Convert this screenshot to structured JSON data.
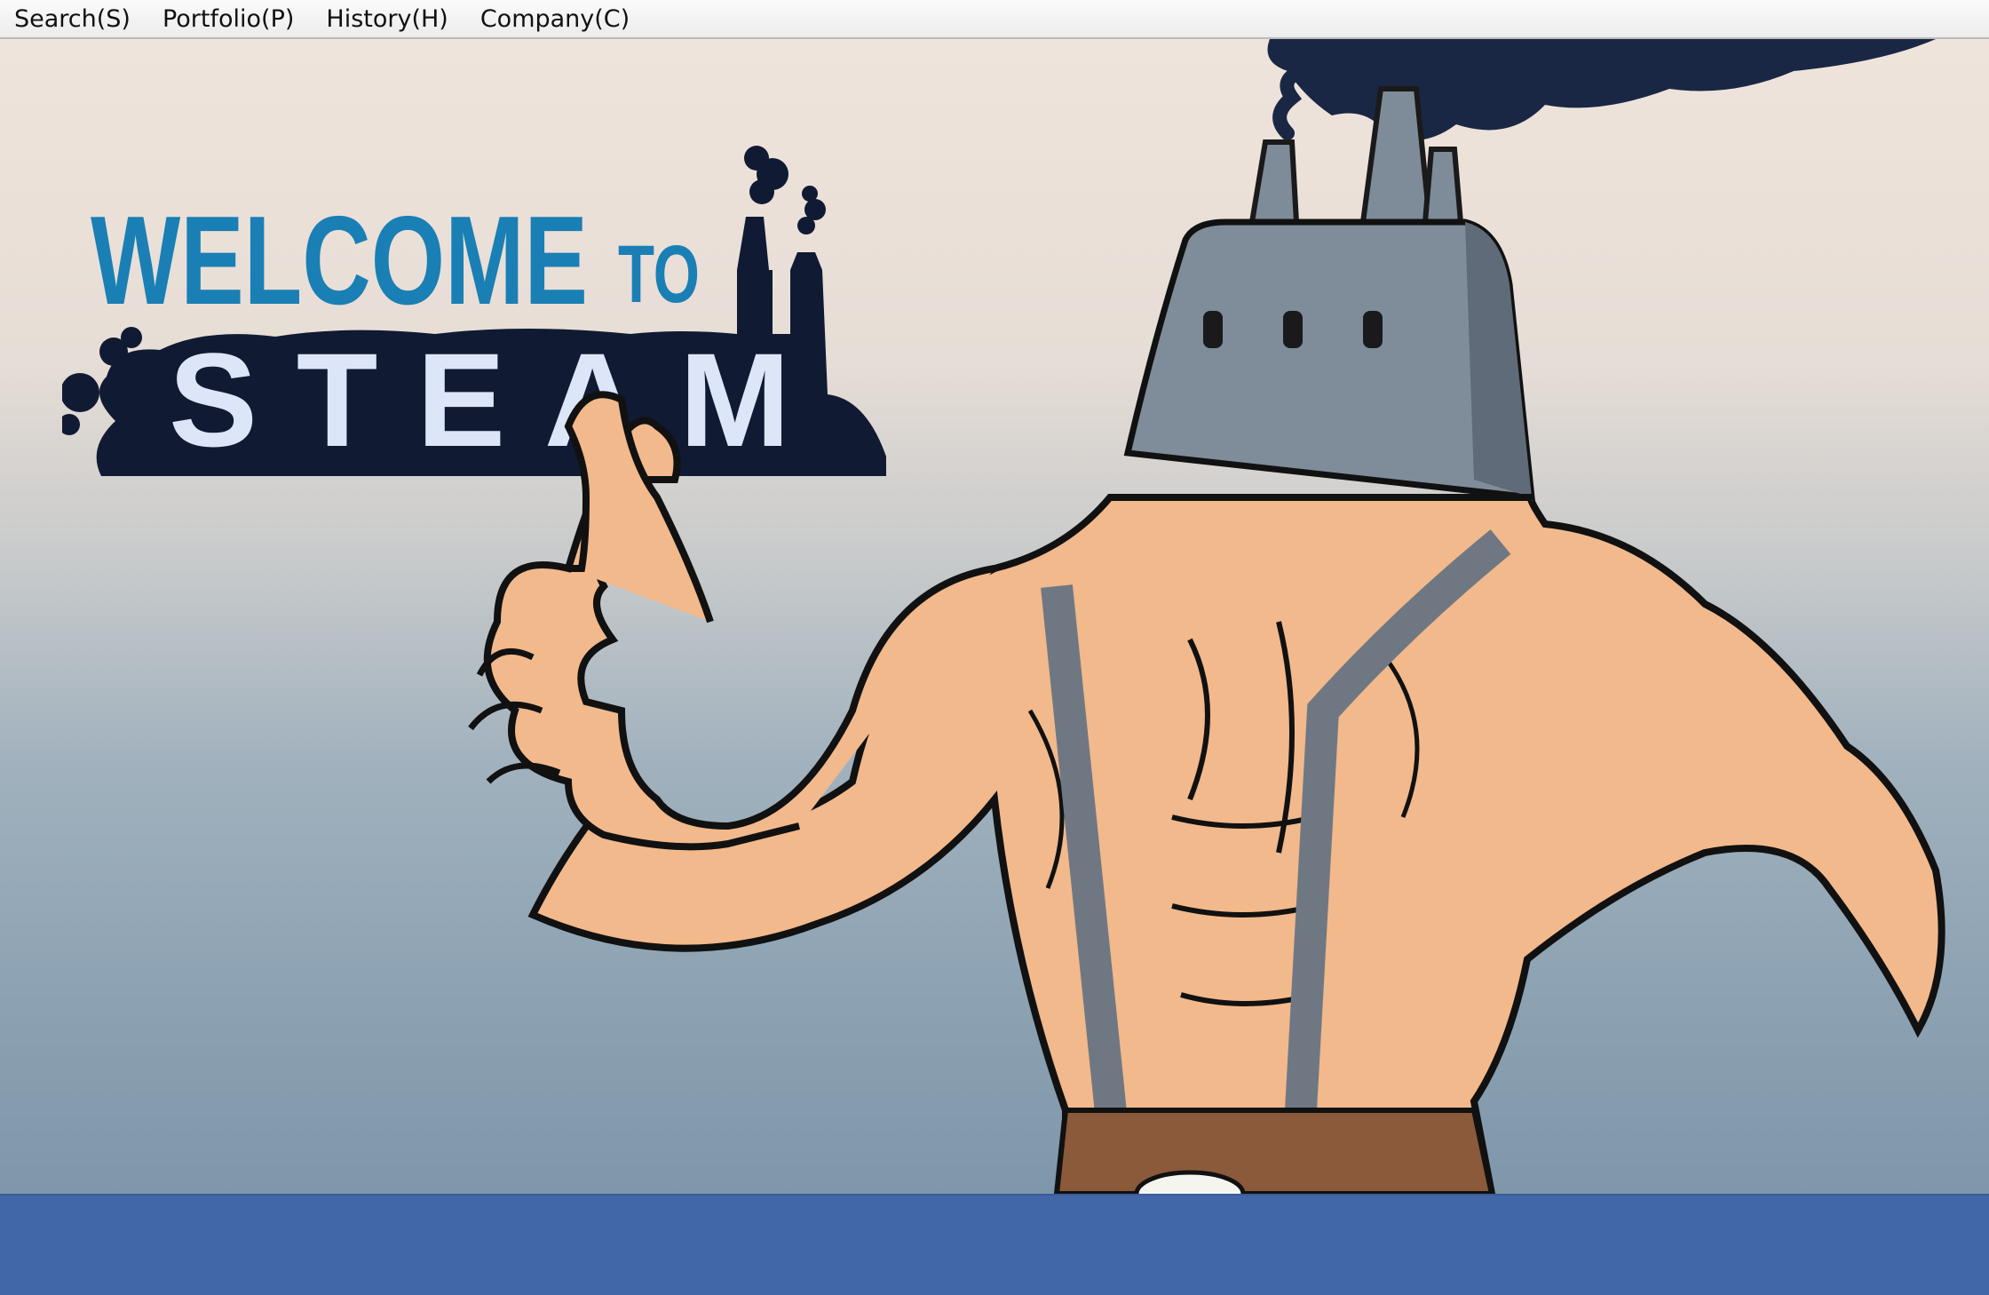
{
  "menubar": {
    "items": [
      "Search(S)",
      "Portfolio(P)",
      "History(H)",
      "Company(C)"
    ]
  },
  "banner": {
    "welcome_text": "WELCOME",
    "to_text": "TO",
    "steam_text": "STEAM",
    "mascot": "steam-mascot-illustration"
  },
  "colors": {
    "welcome_blue": "#1a7fb4",
    "logo_navy": "#111a33",
    "steam_letters": "#dde6f8",
    "bottom_band": "#4267a8"
  }
}
